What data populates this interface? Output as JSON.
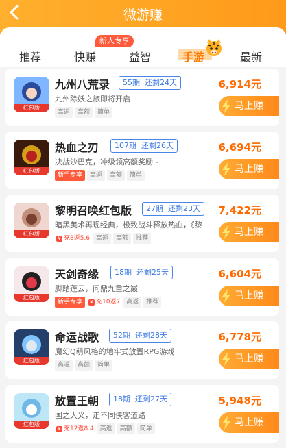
{
  "header": {
    "title": "微游赚"
  },
  "tabs": [
    {
      "label": "推荐"
    },
    {
      "label": "快赚",
      "badge": "新人专享"
    },
    {
      "label": "益智"
    },
    {
      "label": "手游",
      "active": true
    },
    {
      "label": "最新"
    }
  ],
  "icon_tag": "红包版",
  "button_label": "马上赚",
  "games": [
    {
      "name": "九州八荒录",
      "period": "55期",
      "remaining": "还剩24天",
      "price": "6,914元",
      "desc": "九州除妖之旅即将开启",
      "tags": [
        "高返",
        "高额",
        "简单"
      ],
      "newbie": null,
      "recharge": null
    },
    {
      "name": "热血之刃",
      "period": "107期",
      "remaining": "还剩26天",
      "price": "6,694元",
      "desc": "决战沙巴克，冲级领高额奖励~",
      "tags": [
        "高返",
        "高额",
        "简单"
      ],
      "newbie": "新手专享",
      "recharge": null
    },
    {
      "name": "黎明召唤红包版",
      "period": "27期",
      "remaining": "还剩23天",
      "price": "7,422元",
      "desc": "暗黑美术再现经典，极致战斗释放热血，《黎",
      "tags": [
        "高返",
        "高额",
        "推荐"
      ],
      "newbie": null,
      "recharge": "充8返5.6"
    },
    {
      "name": "天剑奇缘",
      "period": "18期",
      "remaining": "还剩25天",
      "price": "6,604元",
      "desc": "脚踏莲云，问鼎九重之巅",
      "tags": [
        "高返",
        "推荐"
      ],
      "newbie": "新手专享",
      "recharge": "充10返7"
    },
    {
      "name": "命运战歌",
      "period": "52期",
      "remaining": "还剩28天",
      "price": "6,778元",
      "desc": "魔幻Q萌风格的地牢式放置RPG游戏",
      "tags": [
        "高返",
        "高额",
        "简单"
      ],
      "newbie": null,
      "recharge": null
    },
    {
      "name": "放置王朝",
      "period": "18期",
      "remaining": "还剩27天",
      "price": "5,948元",
      "desc": "国之大义，走不同侠客道路",
      "tags": [
        "高返",
        "高额",
        "简单"
      ],
      "newbie": null,
      "recharge": "充12返8.4"
    }
  ],
  "colors": {
    "accent": "#ff8a1a",
    "price": "#ff6a00",
    "period_border": "#4a86e8",
    "tag_red": "#e8382e"
  }
}
